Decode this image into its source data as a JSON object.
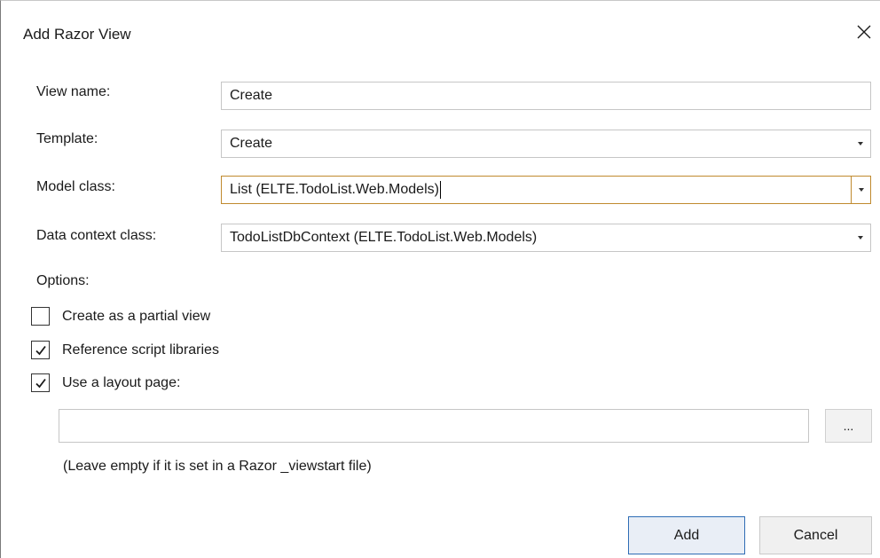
{
  "dialog": {
    "title": "Add Razor View",
    "close_icon": "close-icon"
  },
  "form": {
    "view_name": {
      "label": "View name:",
      "value": "Create"
    },
    "template": {
      "label": "Template:",
      "value": "Create"
    },
    "model_class": {
      "label": "Model class:",
      "value": "List (ELTE.TodoList.Web.Models)"
    },
    "data_context_class": {
      "label": "Data context class:",
      "value": "TodoListDbContext (ELTE.TodoList.Web.Models)"
    }
  },
  "options": {
    "label": "Options:",
    "items": [
      {
        "label": "Create as a partial view",
        "checked": false
      },
      {
        "label": "Reference script libraries",
        "checked": true
      },
      {
        "label": "Use a layout page:",
        "checked": true
      }
    ]
  },
  "layout": {
    "value": "",
    "browse_label": "...",
    "hint": "(Leave empty if it is set in a Razor _viewstart file)"
  },
  "buttons": {
    "add": "Add",
    "cancel": "Cancel"
  },
  "colors": {
    "focus_border": "#c08a2e",
    "default_button_border": "#2f6db5"
  }
}
